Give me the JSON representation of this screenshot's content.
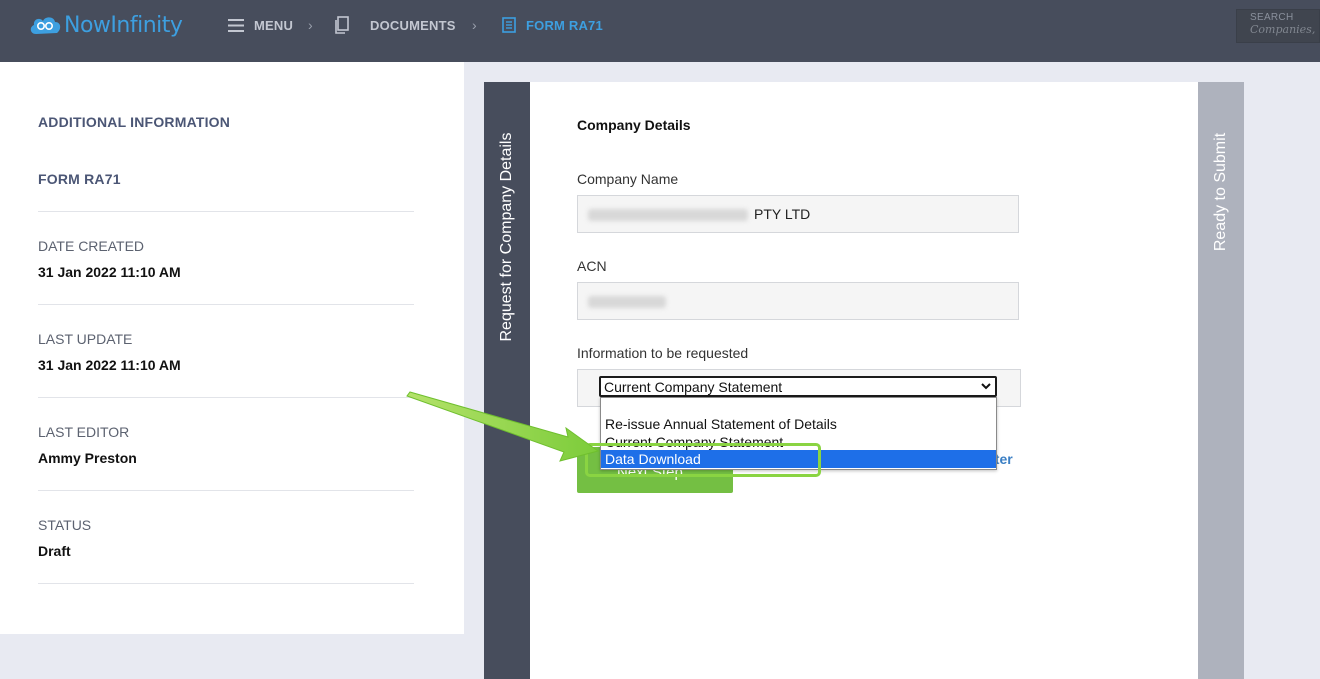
{
  "header": {
    "brand": "NowInfinity",
    "breadcrumb": [
      {
        "label": "MENU"
      },
      {
        "label": "DOCUMENTS"
      },
      {
        "label": "FORM RA71"
      }
    ],
    "search": {
      "label": "SEARCH",
      "placeholder": "Companies,"
    }
  },
  "sidebar": {
    "section_title": "ADDITIONAL INFORMATION",
    "form_name": "FORM RA71",
    "fields": [
      {
        "label": "DATE CREATED",
        "value": "31 Jan 2022 11:10 AM"
      },
      {
        "label": "LAST UPDATE",
        "value": "31 Jan 2022 11:10 AM"
      },
      {
        "label": "LAST EDITOR",
        "value": "Ammy Preston"
      },
      {
        "label": "STATUS",
        "value": "Draft"
      }
    ]
  },
  "steps": {
    "current": "Request for Company Details",
    "next": "Ready to Submit"
  },
  "form": {
    "title": "Company Details",
    "company_name_label": "Company Name",
    "company_name_value": "PTY LTD",
    "acn_label": "ACN",
    "info_label": "Information to be requested",
    "info_selected": "Current Company Statement",
    "info_options": [
      "Re-issue Annual Statement of Details",
      "Current Company Statement",
      "Data Download"
    ],
    "highlighted_option": "Data Download",
    "next_button": "Next Step",
    "later_link": "ater"
  },
  "colors": {
    "header_bg": "#474d5c",
    "accent_blue": "#3d9fe0",
    "button_green": "#74bf43",
    "annotation_green": "#8ad442",
    "dropdown_selected": "#1e6fe8"
  }
}
